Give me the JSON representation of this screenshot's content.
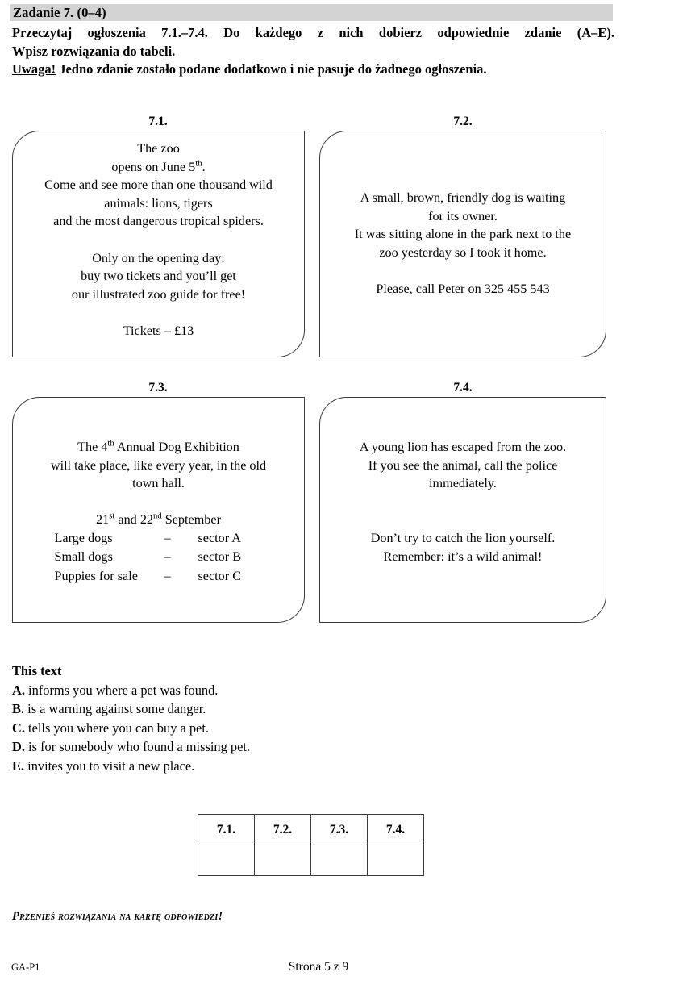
{
  "task": {
    "title": "Zadanie 7. (0–4)",
    "instruction_line_1": "Przeczytaj ogłoszenia 7.1.–7.4. Do każdego z nich dobierz odpowiednie zdanie (A–E).",
    "instruction_line_2": "Wpisz rozwiązania do tabeli.",
    "note_label": "Uwaga!",
    "note_text": "Jedno zdanie zostało podane dodatkowo i nie pasuje do żadnego ogłoszenia."
  },
  "notices": [
    {
      "label": "7.1.",
      "lines": [
        "The zoo",
        "opens on June 5",
        "Come and see more than one thousand wild",
        "animals: lions, tigers",
        "and the most dangerous tropical spiders.",
        "Only on the opening day:",
        "buy two tickets and you’ll get",
        "our illustrated zoo guide for free!",
        "Tickets – £13"
      ],
      "superscript_ordinal": "th",
      "line2_tail": "."
    },
    {
      "label": "7.2.",
      "lines": [
        "A small, brown, friendly dog is waiting",
        "for its owner.",
        "It was sitting alone in the park next to the",
        "zoo yesterday so I took it home.",
        "Please, call Peter on 325 455 543"
      ]
    },
    {
      "label": "7.3.",
      "lines": [
        "The 4",
        " Annual Dog Exhibition",
        "will take place, like every year, in the old",
        "town hall.",
        " and 22",
        " September"
      ],
      "exhibition_ordinal": "th",
      "date_first": "21",
      "date_first_ordinal": "st",
      "date_second": "22",
      "date_second_ordinal": "nd",
      "date_month": " September",
      "date_joiner": " and ",
      "sectors": [
        {
          "name": "Large dogs",
          "dash": "–",
          "value": "sector A"
        },
        {
          "name": "Small dogs",
          "dash": "–",
          "value": "sector B"
        },
        {
          "name": "Puppies for sale",
          "dash": "–",
          "value": "sector C"
        }
      ]
    },
    {
      "label": "7.4.",
      "lines": [
        "A young lion has escaped from the zoo.",
        "If you see the animal, call the police",
        "immediately.",
        "Don’t try to catch the lion yourself.",
        "Remember: it’s a wild animal!"
      ]
    }
  ],
  "options": {
    "heading": "This text",
    "items": [
      {
        "letter": "A.",
        "text": "informs you where a pet was found."
      },
      {
        "letter": "B.",
        "text": "is a warning against some danger."
      },
      {
        "letter": "C.",
        "text": "tells you where you can buy a pet."
      },
      {
        "letter": "D.",
        "text": "is for somebody who found a missing pet."
      },
      {
        "letter": "E.",
        "text": "invites you to visit a new place."
      }
    ]
  },
  "answer_table": {
    "headers": [
      "7.1.",
      "7.2.",
      "7.3.",
      "7.4."
    ],
    "answers": [
      "",
      "",
      "",
      ""
    ]
  },
  "footer": {
    "transfer_note": "Przenieś rozwiązania na kartę odpowiedzi!",
    "left": "GA-P1",
    "center": "Strona 5 z 9"
  },
  "colors": {
    "band": "#d3d3d3",
    "border": "#3a3a3a",
    "text": "#000000"
  }
}
